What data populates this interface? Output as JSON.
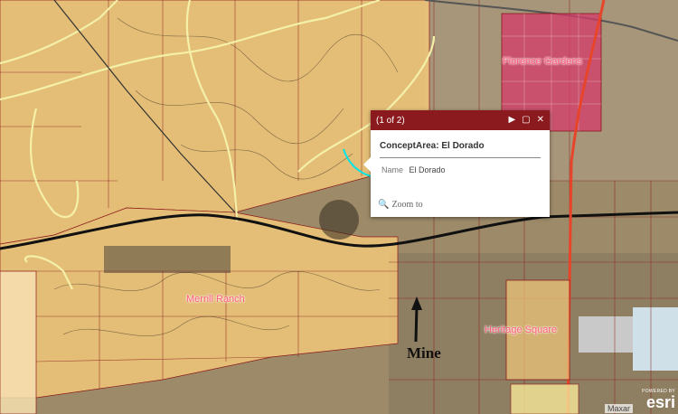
{
  "map": {
    "labels": {
      "florence_gardens": "Florence Gardens",
      "merrill_ranch": "Merrill Ranch",
      "heritage_square": "Heritage Square",
      "mine": "Mine"
    },
    "colors": {
      "parcel_fill": "#f1c77a",
      "parcel_outline": "#8b1a1a",
      "road": "#f4f0a8",
      "highway": "#e8442a",
      "railroad": "#111111",
      "highlight": "#00e5e5"
    }
  },
  "popup": {
    "count": "(1 of 2)",
    "title": "ConceptArea: El Dorado",
    "attr_name_label": "Name",
    "attr_name_value": "El Dorado",
    "zoom_label": "Zoom to",
    "header_color": "#8a1a1d"
  },
  "footer": {
    "attribution": "Maxar",
    "powered_by": "POWERED BY",
    "esri": "esri"
  }
}
